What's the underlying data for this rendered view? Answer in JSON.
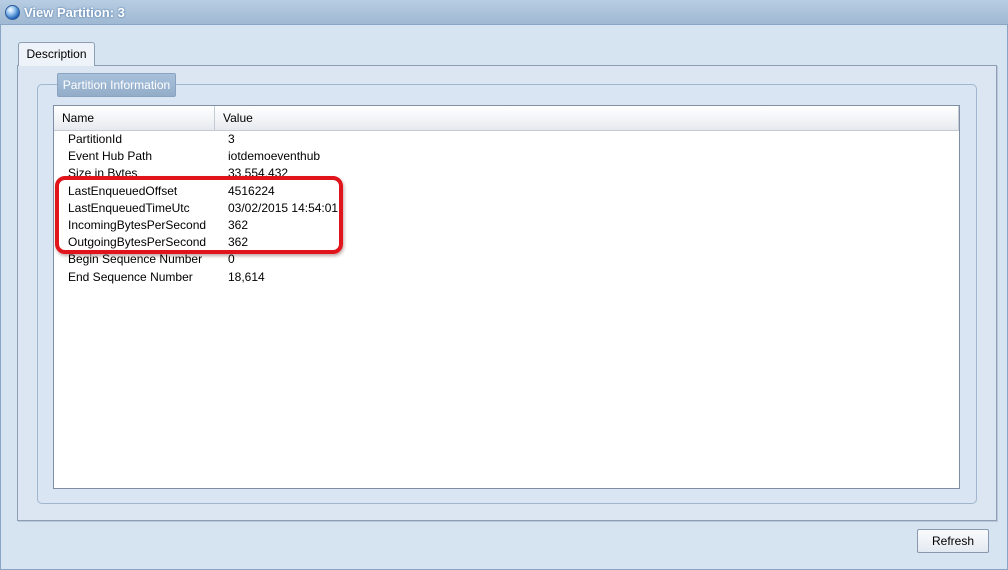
{
  "window": {
    "title": "View Partition: 3",
    "icon": "globe-icon"
  },
  "tabs": [
    {
      "label": "Description",
      "selected": true
    }
  ],
  "group": {
    "title": "Partition Information"
  },
  "grid": {
    "columns": [
      "Name",
      "Value"
    ],
    "rows": [
      {
        "name": "PartitionId",
        "value": "3"
      },
      {
        "name": "Event Hub Path",
        "value": "iotdemoeventhub"
      },
      {
        "name": "Size in Bytes",
        "value": "33,554,432"
      },
      {
        "name": "LastEnqueuedOffset",
        "value": "4516224"
      },
      {
        "name": "LastEnqueuedTimeUtc",
        "value": "03/02/2015 14:54:01"
      },
      {
        "name": "IncomingBytesPerSecond",
        "value": "362"
      },
      {
        "name": "OutgoingBytesPerSecond",
        "value": "362"
      },
      {
        "name": "Begin Sequence Number",
        "value": "0"
      },
      {
        "name": "End Sequence Number",
        "value": "18,614"
      }
    ]
  },
  "buttons": {
    "refresh_label": "Refresh"
  },
  "colors": {
    "highlight": "#e1141c",
    "title_bar": "#9fb8d3",
    "group_title": "#a9c1db"
  }
}
